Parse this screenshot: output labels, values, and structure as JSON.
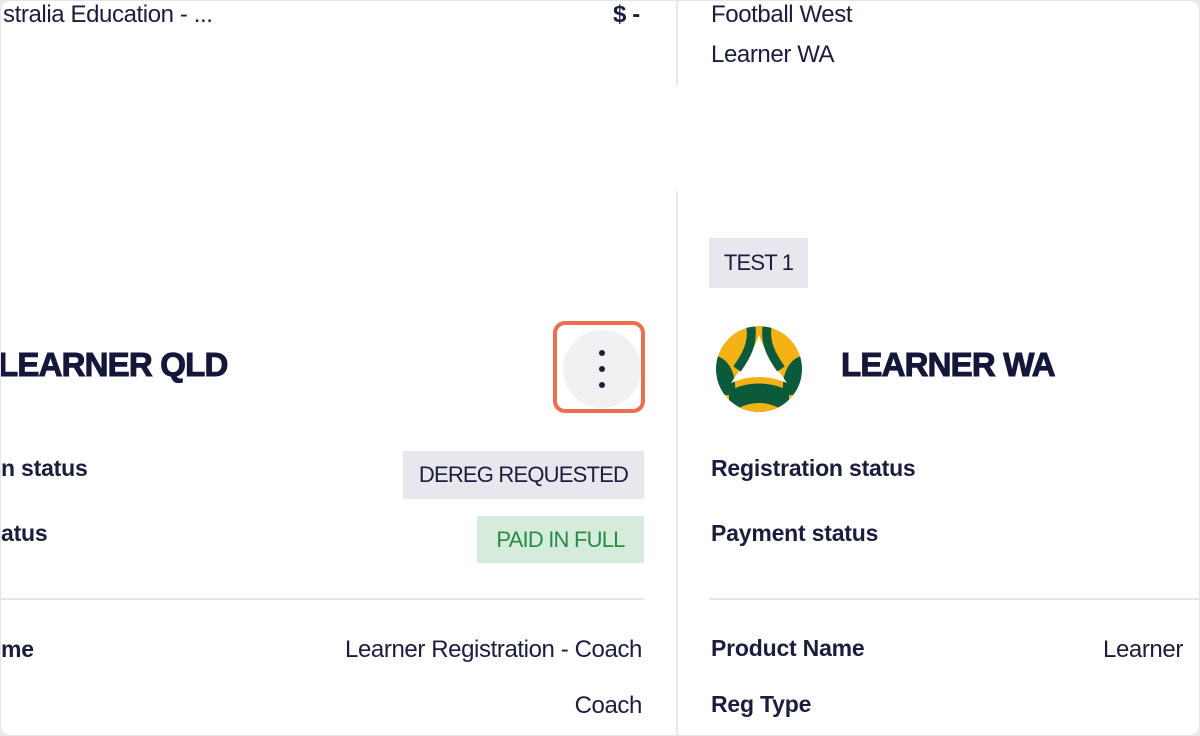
{
  "left_card_top": {
    "product_name": "stralia Education - ...",
    "price": "$ -"
  },
  "right_card_top": {
    "association": "Football West",
    "team": "Learner WA"
  },
  "left_card": {
    "title": "LEARNER QLD",
    "registration_status_label": "n status",
    "registration_status_badge": "DEREG REQUESTED",
    "payment_status_label": "atus",
    "payment_status_badge": "PAID IN FULL",
    "product_name_label": "me",
    "product_name_value": "Learner Registration - Coach",
    "reg_type_value": "Coach"
  },
  "right_card": {
    "tag": "TEST 1",
    "logo": "football-australia-logo",
    "title": "LEARNER WA",
    "registration_status_label": "Registration status",
    "payment_status_label": "Payment status",
    "product_name_label": "Product Name",
    "product_name_value": "Learner",
    "reg_type_label": "Reg Type"
  },
  "actions": {
    "menu_icon": "kebab-menu-icon"
  },
  "colors": {
    "accent_highlight": "#ee6f4d",
    "badge_grey_bg": "#e7e7ed",
    "badge_green_bg": "#d5ecdb",
    "badge_green_text": "#2a8a46",
    "logo_green": "#0b5a3a",
    "logo_gold": "#f5b214",
    "title_navy": "#14163a"
  }
}
